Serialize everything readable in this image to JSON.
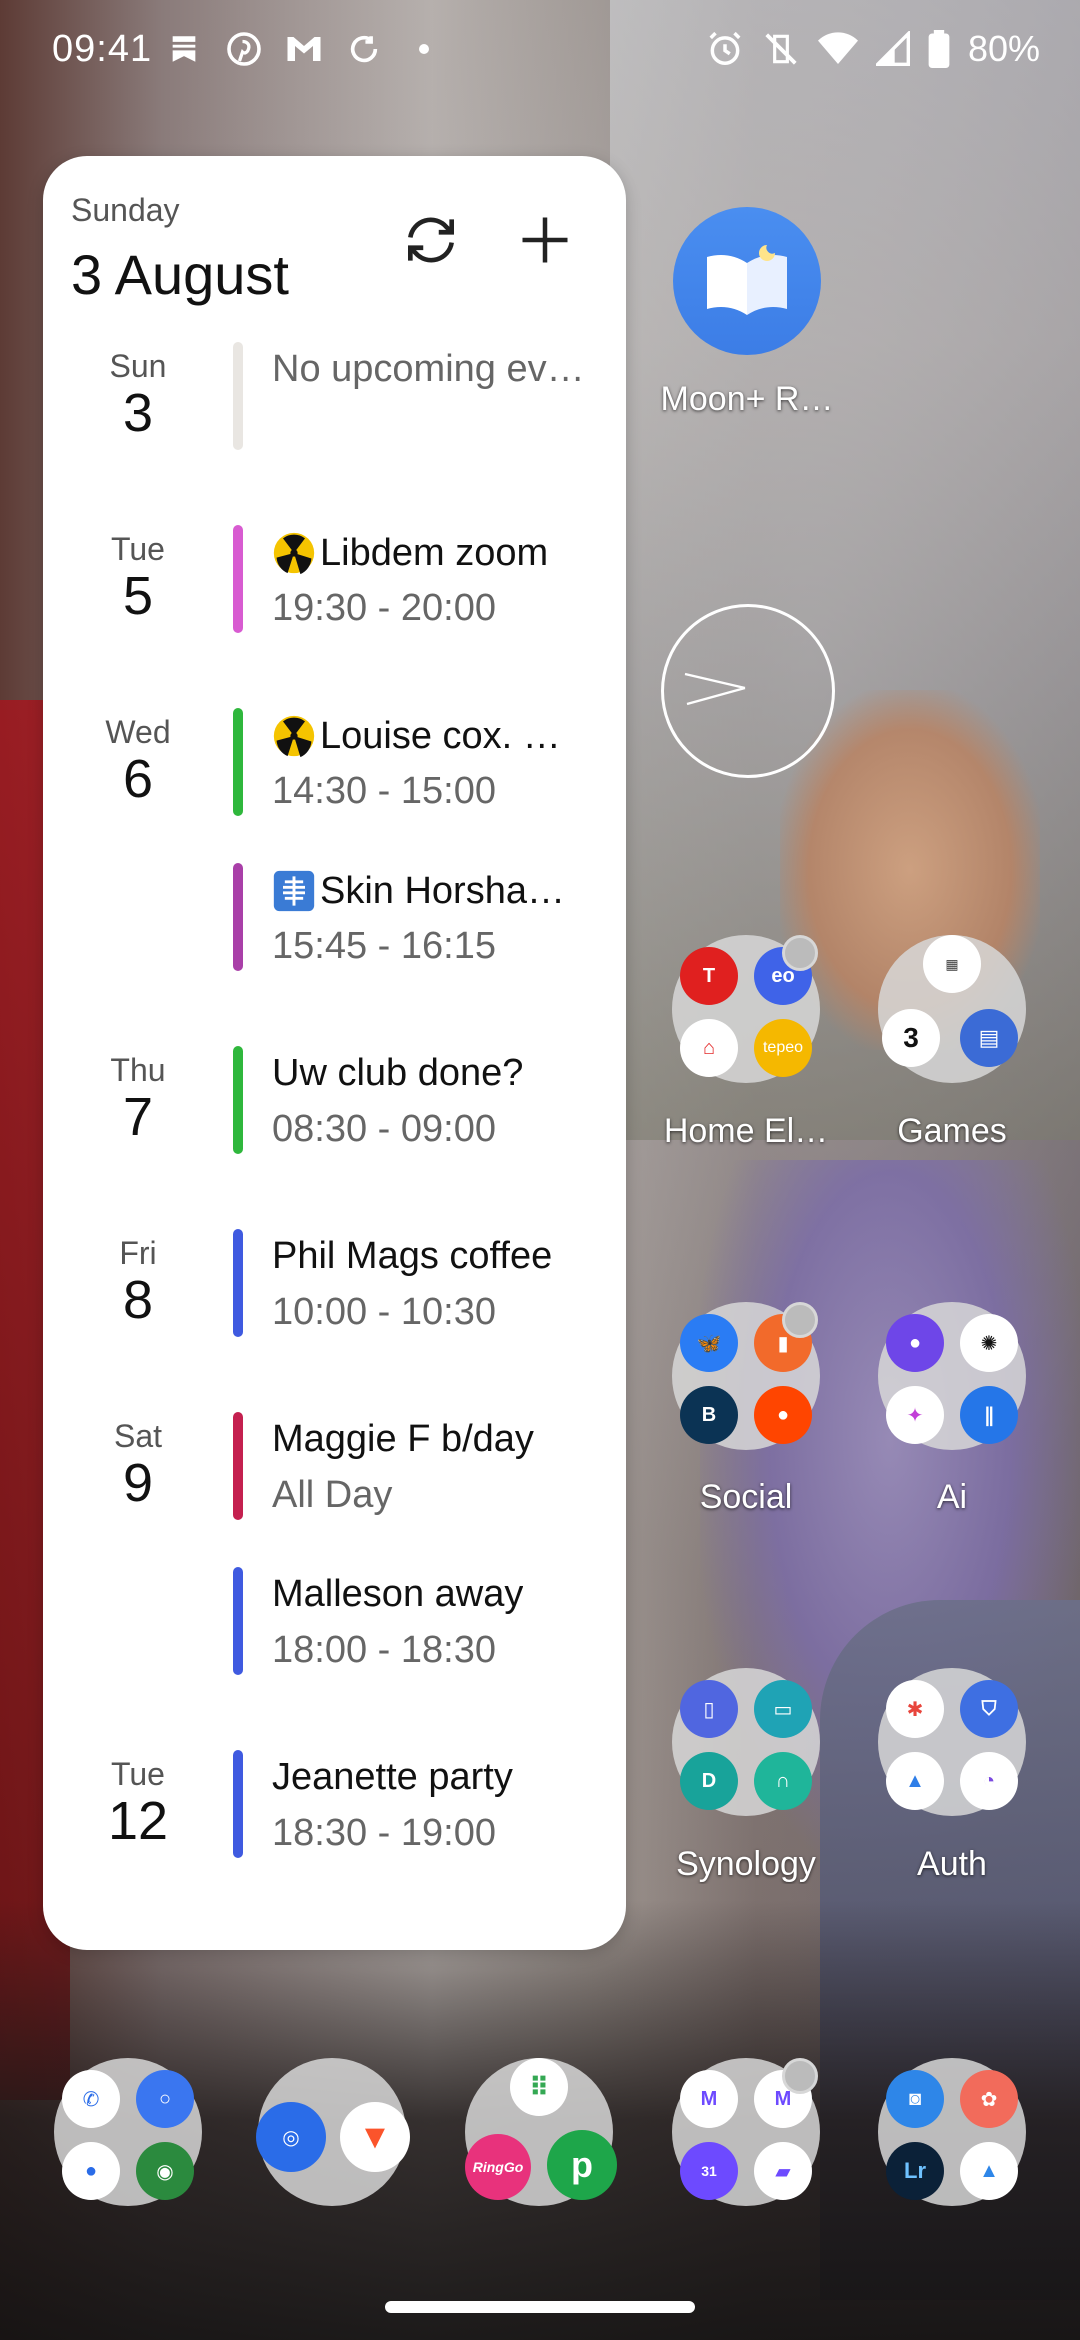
{
  "status_bar": {
    "time": "09:41",
    "left_icons": [
      "notification-bookmark-icon",
      "pinterest-icon",
      "gmail-icon",
      "sync-icon",
      "dot-icon"
    ],
    "right_icons": [
      "alarm-icon",
      "vibrate-off-icon",
      "wifi-icon",
      "signal-icon",
      "battery-icon"
    ],
    "battery_percent": "80%"
  },
  "calendar_widget": {
    "day_name": "Sunday",
    "date": "3 August",
    "refresh_label": "refresh",
    "add_label": "add event",
    "rows": [
      {
        "dow": "Sun",
        "day": "3",
        "title": "No upcoming ev…",
        "time": "",
        "color": "#e9e6e2",
        "icon": ""
      },
      {
        "dow": "Tue",
        "day": "5",
        "title": "Libdem zoom",
        "time": "19:30 - 20:00",
        "color": "#d85bd1",
        "icon": "radioactive-icon"
      },
      {
        "dow": "Wed",
        "day": "6",
        "title": "Louise cox. …",
        "time": "14:30 - 15:00",
        "color": "#2fb73c",
        "icon": "radioactive-icon"
      },
      {
        "dow": "",
        "day": "",
        "title": "Skin Horsha…",
        "time": "15:45 - 16:15",
        "color": "#a93fa8",
        "icon": "xray-icon"
      },
      {
        "dow": "Thu",
        "day": "7",
        "title": "Uw club done?",
        "time": "08:30 - 09:00",
        "color": "#2fb73c",
        "icon": ""
      },
      {
        "dow": "Fri",
        "day": "8",
        "title": "Phil Mags coffee",
        "time": "10:00 - 10:30",
        "color": "#3f5ae0",
        "icon": ""
      },
      {
        "dow": "Sat",
        "day": "9",
        "title": "Maggie F b/day",
        "time": "All Day",
        "color": "#c4204f",
        "icon": ""
      },
      {
        "dow": "",
        "day": "",
        "title": "Malleson away",
        "time": "18:00 - 18:30",
        "color": "#3f5ae0",
        "icon": ""
      },
      {
        "dow": "Tue",
        "day": "12",
        "title": "Jeanette party",
        "time": "18:30 - 19:00",
        "color": "#3f5ae0",
        "icon": ""
      }
    ]
  },
  "home": {
    "moon_reader_label": "Moon+ R…",
    "folders": {
      "home_el": "Home El…",
      "games": "Games",
      "social": "Social",
      "ai": "Ai",
      "synology": "Synology",
      "auth": "Auth"
    },
    "mini_labels": {
      "tepeo": "tepeo",
      "ringgo": "RingGo",
      "lr": "Lr",
      "games_3": "3",
      "gmail_31": "31"
    }
  },
  "colors": {
    "widget_bg": "#ffffff",
    "folder_bg": "#d7d7d7"
  }
}
